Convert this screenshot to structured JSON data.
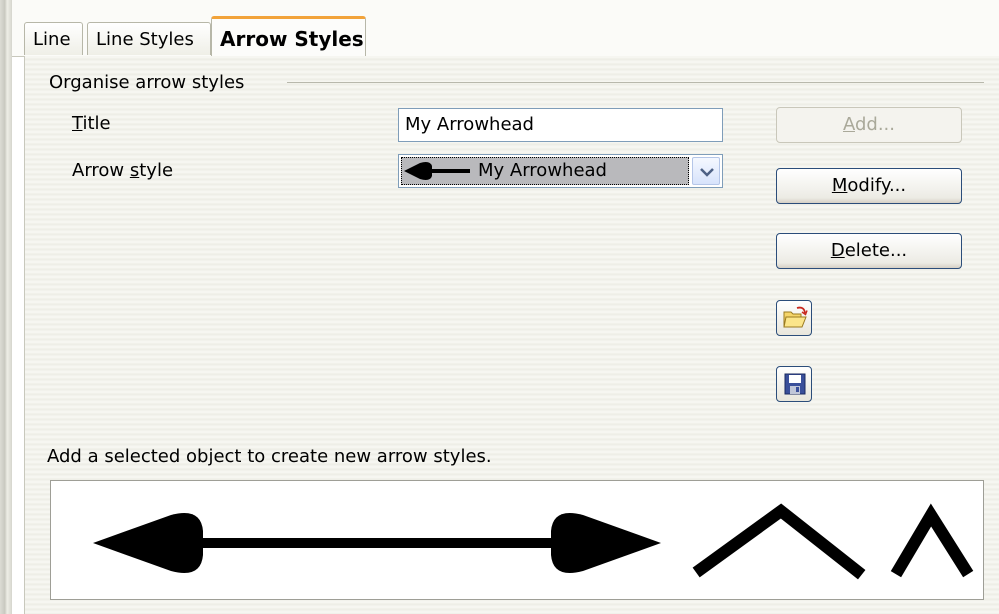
{
  "tabs": [
    "Line",
    "Line Styles",
    "Arrow Styles"
  ],
  "active_tab": "Arrow Styles",
  "group": {
    "label": "Organise arrow styles"
  },
  "title_field": {
    "label_first": "T",
    "label_rest": "itle",
    "value": "My Arrowhead"
  },
  "arrow_style": {
    "label_before": "Arrow ",
    "label_key": "s",
    "label_after": "tyle",
    "selected": "My Arrowhead"
  },
  "buttons": {
    "add": {
      "key": "A",
      "rest": "dd..."
    },
    "modify": {
      "key": "M",
      "rest": "odify..."
    },
    "delete": {
      "key": "D",
      "rest": "elete..."
    }
  },
  "icons": {
    "load": "open-folder-icon",
    "save": "floppy-disk-icon"
  },
  "hint": "Add a selected object to create new arrow styles.",
  "colors": {
    "active_tab_accent": "#f2a33a",
    "button_border": "#2b4d7a",
    "field_border": "#7f9db9"
  }
}
